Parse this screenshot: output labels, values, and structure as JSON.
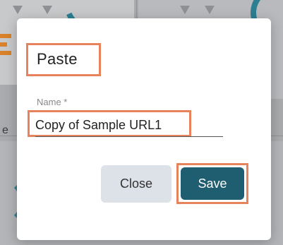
{
  "dialog": {
    "title": "Paste",
    "name_label": "Name *",
    "name_value": "Copy of Sample URL1",
    "close_label": "Close",
    "save_label": "Save"
  },
  "background": {
    "partial_text": "e"
  },
  "colors": {
    "highlight": "#e8825c",
    "save_button": "#1f5d70",
    "close_button": "#dde1e8",
    "backdrop": "#a9abae"
  }
}
